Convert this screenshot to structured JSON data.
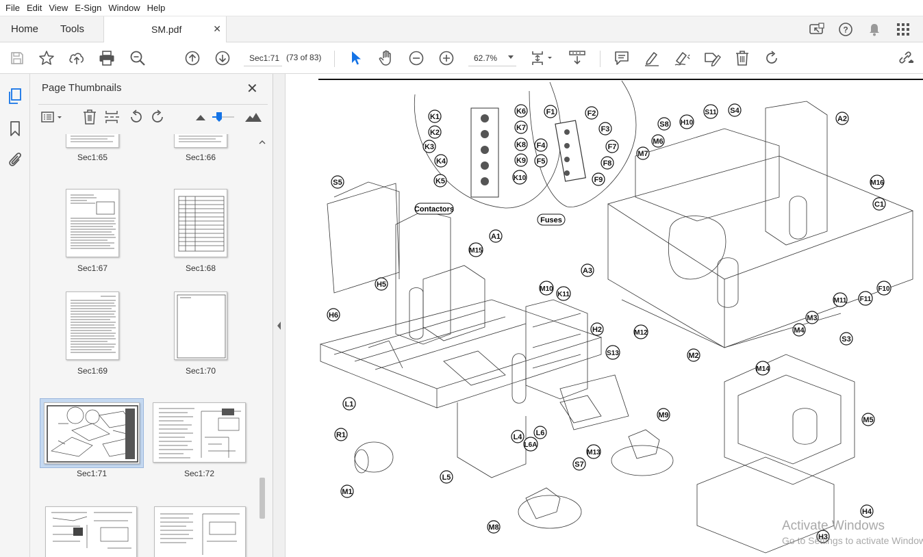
{
  "menu": [
    "File",
    "Edit",
    "View",
    "E-Sign",
    "Window",
    "Help"
  ],
  "tabs": {
    "home": "Home",
    "tools": "Tools",
    "document": "SM.pdf"
  },
  "toolbar": {
    "page_field": "Sec1:71",
    "page_count": "(73 of 83)",
    "zoom": "62.7%"
  },
  "panel": {
    "title": "Page Thumbnails",
    "thumbnails": [
      {
        "label": "Sec1:65"
      },
      {
        "label": "Sec1:66"
      },
      {
        "label": "Sec1:67"
      },
      {
        "label": "Sec1:68"
      },
      {
        "label": "Sec1:69"
      },
      {
        "label": "Sec1:70"
      },
      {
        "label": "Sec1:71",
        "selected": true
      },
      {
        "label": "Sec1:72"
      },
      {
        "label": ""
      },
      {
        "label": ""
      }
    ]
  },
  "diagram": {
    "callouts": [
      "K1",
      "K2",
      "K3",
      "K4",
      "K5",
      "K6",
      "K7",
      "K8",
      "K9",
      "K10",
      "F1",
      "F2",
      "F3",
      "F4",
      "F5",
      "F7",
      "F8",
      "F9",
      "F10",
      "F11",
      "S4",
      "S5",
      "S7",
      "S8",
      "S11",
      "S13",
      "S3",
      "H10",
      "H2",
      "H3",
      "H4",
      "H5",
      "H6",
      "A1",
      "A2",
      "A3",
      "C1",
      "M1",
      "M2",
      "M3",
      "M4",
      "M5",
      "M6",
      "M7",
      "M8",
      "M9",
      "M10",
      "M11",
      "M12",
      "M13",
      "M14",
      "M15",
      "M16",
      "K11",
      "L1",
      "L4",
      "L5",
      "L6",
      "L6A",
      "R1"
    ],
    "labels": {
      "contactors": "Contactors",
      "fuses": "Fuses"
    }
  },
  "watermark": {
    "line1": "Activate Windows",
    "line2": "Go to Settings to activate Windows."
  },
  "colors": {
    "accent": "#1473e6",
    "selection": "#c5d9f1"
  }
}
